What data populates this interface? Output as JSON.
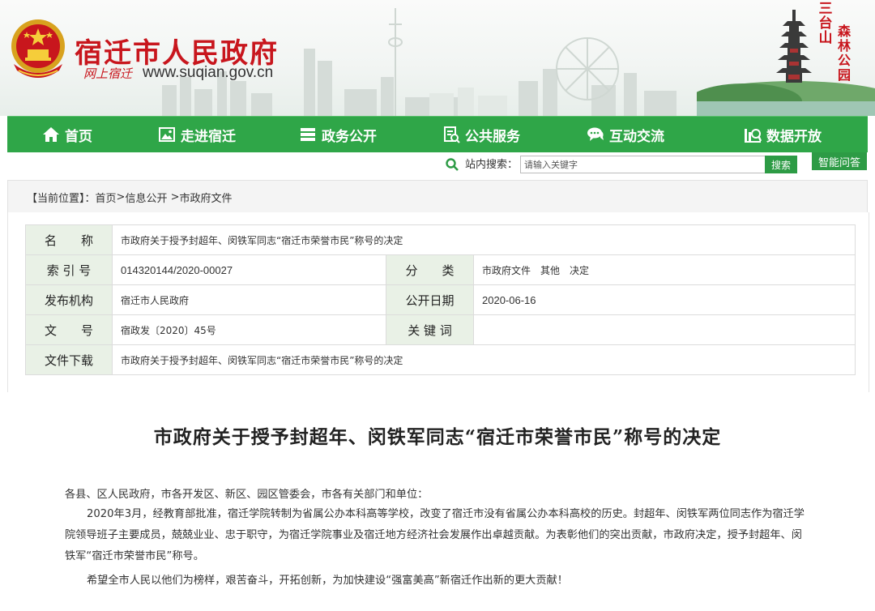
{
  "header": {
    "site_title": "宿迁市人民政府",
    "slogan": "网上宿迁",
    "url": "www.suqian.gov.cn",
    "calligraphy_1": "三台山",
    "calligraphy_2": "森林公园"
  },
  "nav": {
    "items": [
      {
        "label": "首页",
        "icon": "home-icon"
      },
      {
        "label": "走进宿迁",
        "icon": "image-icon"
      },
      {
        "label": "政务公开",
        "icon": "list-icon"
      },
      {
        "label": "公共服务",
        "icon": "service-icon"
      },
      {
        "label": "互动交流",
        "icon": "chat-icon"
      },
      {
        "label": "数据开放",
        "icon": "data-icon"
      }
    ],
    "bg_color": "#2fa648"
  },
  "search": {
    "label": "站内搜索：",
    "placeholder": "请输入关键字",
    "button": "搜索",
    "ai_button": "智能问答"
  },
  "breadcrumb": {
    "label": "【当前位置】：",
    "items": [
      "首页",
      "信息公开",
      "市政府文件"
    ],
    "sep": ">"
  },
  "info": {
    "name_label": "名　　称",
    "name_value": "市政府关于授予封超年、闵铁军同志“宿迁市荣誉市民”称号的决定",
    "index_label": "索 引 号",
    "index_value": "014320144/2020-00027",
    "category_label": "分　　类",
    "category_value": "市政府文件　其他　决定",
    "publisher_label": "发布机构",
    "publisher_value": "宿迁市人民政府",
    "date_label": "公开日期",
    "date_value": "2020-06-16",
    "docno_label": "文　　号",
    "docno_value": "宿政发〔2020〕45号",
    "keywords_label": "关 键 词",
    "keywords_value": "",
    "download_label": "文件下载",
    "download_value": "市政府关于授予封超年、闵铁军同志“宿迁市荣誉市民”称号的决定"
  },
  "article": {
    "title": "市政府关于授予封超年、闵铁军同志“宿迁市荣誉市民”称号的决定",
    "salutation": "各县、区人民政府，市各开发区、新区、园区管委会，市各有关部门和单位：",
    "paragraph_1": "2020年3月，经教育部批准，宿迁学院转制为省属公办本科高等学校，改变了宿迁市没有省属公办本科高校的历史。封超年、闵铁军两位同志作为宿迁学院领导班子主要成员，兢兢业业、忠于职守，为宿迁学院事业及宿迁地方经济社会发展作出卓越贡献。为表彰他们的突出贡献，市政府决定，授予封超年、闵铁军“宿迁市荣誉市民”称号。",
    "paragraph_2": "希望全市人民以他们为榜样，艰苦奋斗，开拓创新，为加快建设“强富美高”新宿迁作出新的更大贡献！"
  },
  "colors": {
    "brand_red": "#c8161d",
    "green": "#2fa648",
    "label_bg": "#e9f1e6"
  }
}
